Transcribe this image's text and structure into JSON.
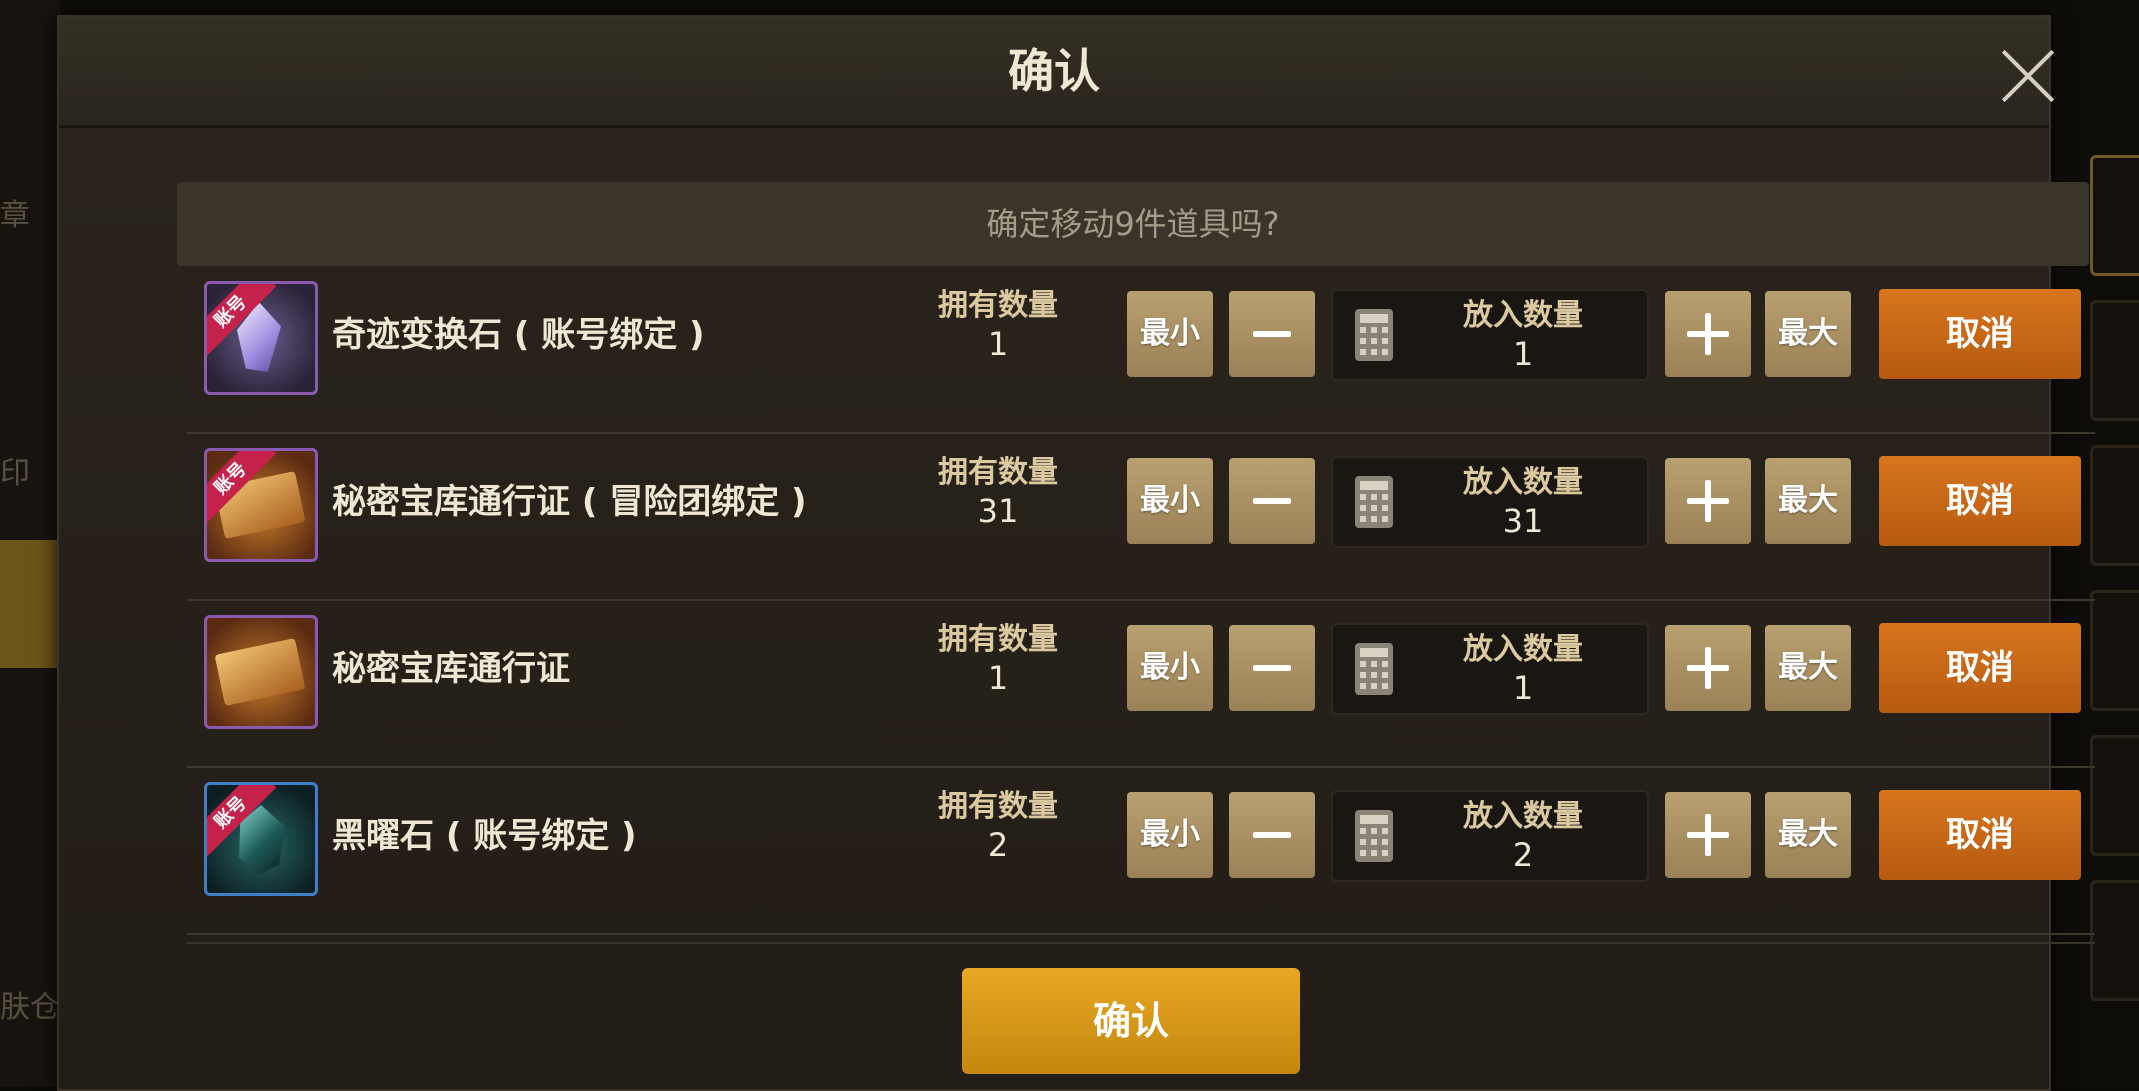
{
  "dialog": {
    "title": "确认",
    "prompt": "确定移动9件道具吗?",
    "confirm_label": "确认"
  },
  "background": {
    "left_labels": [
      "章",
      "印",
      "肤仓"
    ]
  },
  "labels": {
    "owned": "拥有数量",
    "put_in": "放入数量",
    "min": "最小",
    "max": "最大",
    "cancel": "取消",
    "bind_badge": "账号"
  },
  "items": [
    {
      "name": "奇迹变换石 ( 账号绑定 )",
      "owned": "1",
      "put_in": "1",
      "icon": "crystal-icon",
      "badge": true
    },
    {
      "name": "秘密宝库通行证 ( 冒险团绑定 )",
      "owned": "31",
      "put_in": "31",
      "icon": "ticket-icon",
      "badge": true
    },
    {
      "name": "秘密宝库通行证",
      "owned": "1",
      "put_in": "1",
      "icon": "ticket-icon",
      "badge": false
    },
    {
      "name": "黑曜石 ( 账号绑定 )",
      "owned": "2",
      "put_in": "2",
      "icon": "obsidian-icon",
      "badge": true
    }
  ],
  "colors": {
    "cancel": "#c8671a",
    "confirm": "#d99b1a",
    "control": "#a88e63"
  }
}
